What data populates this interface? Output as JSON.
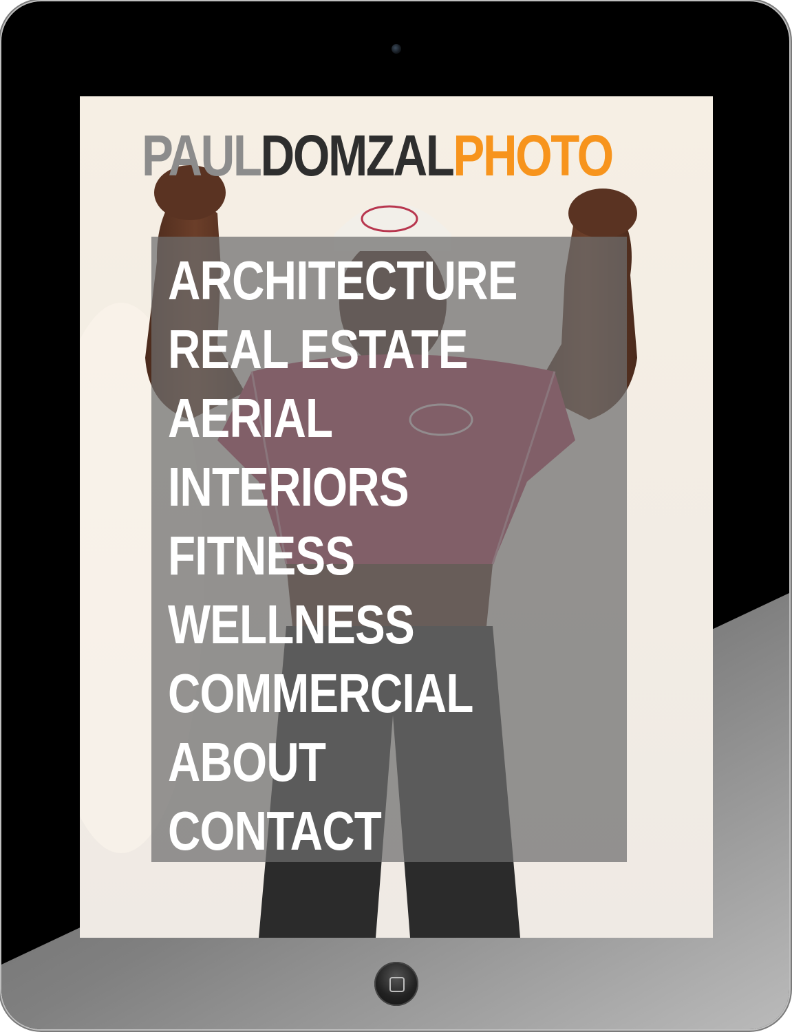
{
  "brand": {
    "part1": "PAUL",
    "part2": "DOMZAL",
    "part3": "PHOTO",
    "colors": {
      "part1": "#8c8c8c",
      "part2": "#2e2e2e",
      "part3": "#f7941d"
    }
  },
  "menu": {
    "items": [
      {
        "label": "ARCHITECTURE"
      },
      {
        "label": "REAL ESTATE"
      },
      {
        "label": "AERIAL"
      },
      {
        "label": "INTERIORS"
      },
      {
        "label": "FITNESS"
      },
      {
        "label": "WELLNESS"
      },
      {
        "label": "COMMERCIAL"
      },
      {
        "label": "ABOUT"
      },
      {
        "label": "CONTACT"
      }
    ],
    "text_color": "#ffffff",
    "panel_color": "#6e6e6e"
  },
  "icons": {
    "camera": "camera-icon",
    "home_button": "home-button-icon"
  }
}
